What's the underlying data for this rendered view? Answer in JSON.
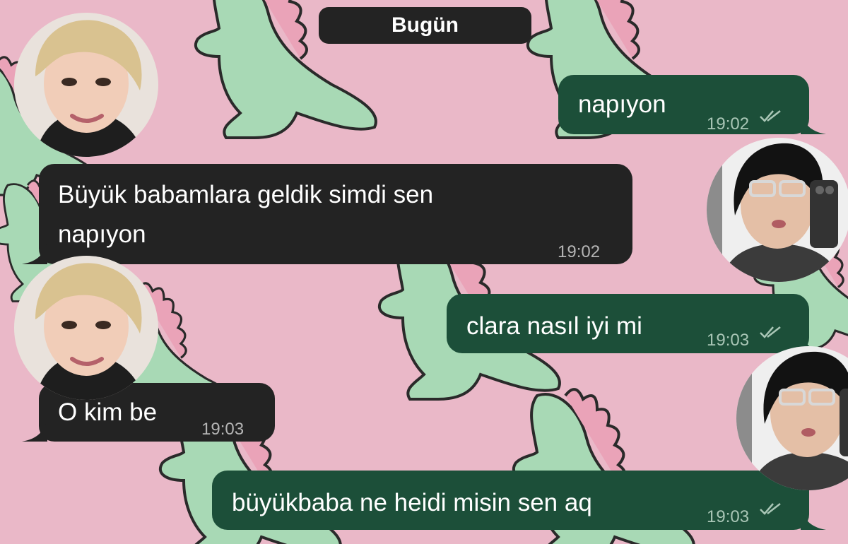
{
  "chat": {
    "date_label": "Bugün",
    "messages": [
      {
        "direction": "outgoing",
        "text": "napıyon",
        "time": "19:02",
        "status": "read"
      },
      {
        "direction": "incoming",
        "text_lines": [
          "Büyük babamlara geldik simdi sen",
          "napıyon"
        ],
        "time": "19:02"
      },
      {
        "direction": "outgoing",
        "text": "clara nasıl iyi mi",
        "time": "19:03",
        "status": "read"
      },
      {
        "direction": "incoming",
        "text": "O kim be",
        "time": "19:03"
      },
      {
        "direction": "outgoing",
        "text": "büyükbaba ne heidi misin sen aq",
        "time": "19:03",
        "status": "read"
      }
    ]
  },
  "theme": {
    "wallpaper_color": "#eab8c8",
    "dino_color": "#a8d9b5",
    "incoming_bubble": "#232323",
    "outgoing_bubble": "#1c4f39"
  },
  "icons": {
    "read_receipt": "double-check-icon",
    "left_avatar": "contact-avatar",
    "right_avatar": "user-avatar"
  }
}
